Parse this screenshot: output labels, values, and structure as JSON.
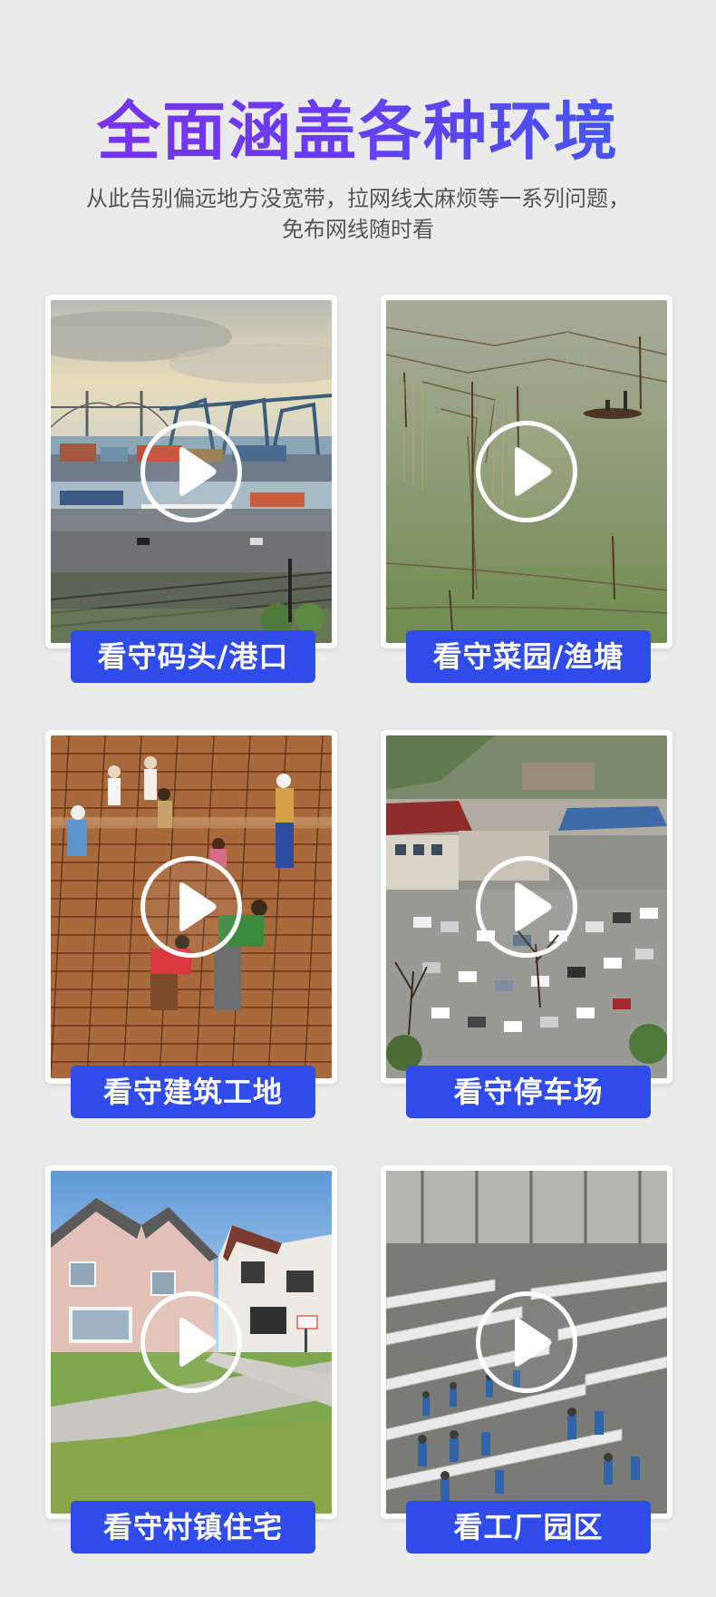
{
  "header": {
    "title": "全面涵盖各种环境",
    "subtitle": "从此告别偏远地方没宽带，拉网线太麻烦等一系列问题，免布网线随时看"
  },
  "colors": {
    "title_gradient_start": "#7b2ff0",
    "title_gradient_end": "#3b5cf5",
    "label_background": "#2f4bea",
    "page_background": "#ebebeb"
  },
  "cards": [
    {
      "label": "看守码头/港口",
      "icon": "play-icon",
      "scene": "port"
    },
    {
      "label": "看守菜园/渔塘",
      "icon": "play-icon",
      "scene": "fishpond"
    },
    {
      "label": "看守建筑工地",
      "icon": "play-icon",
      "scene": "construction"
    },
    {
      "label": "看守停车场",
      "icon": "play-icon",
      "scene": "parking"
    },
    {
      "label": "看守村镇住宅",
      "icon": "play-icon",
      "scene": "houses"
    },
    {
      "label": "看工厂园区",
      "icon": "play-icon",
      "scene": "factory"
    }
  ]
}
